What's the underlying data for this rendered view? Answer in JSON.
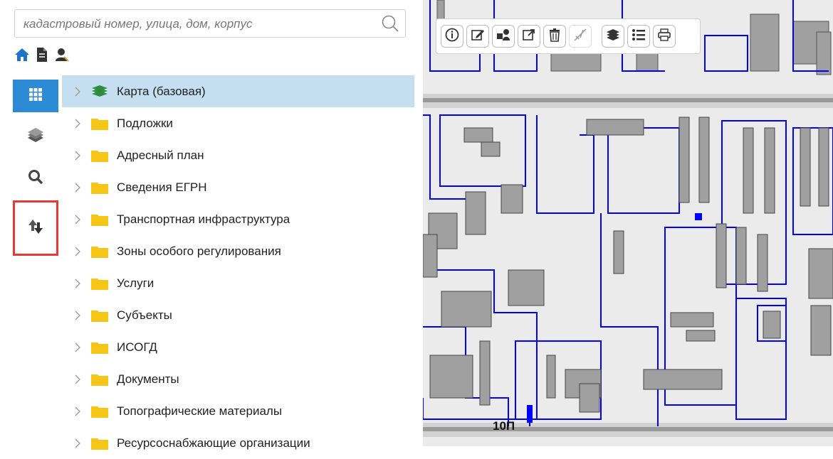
{
  "search": {
    "placeholder": "кадастровый номер, улица, дом, корпус"
  },
  "quick_icons": [
    "home-icon",
    "document-icon",
    "user-icon"
  ],
  "rail": [
    {
      "icon": "grid-icon",
      "active": true
    },
    {
      "icon": "layers-icon",
      "active": false
    },
    {
      "icon": "search-icon",
      "active": false
    },
    {
      "icon": "swap-icon",
      "active": false,
      "highlighted": true
    }
  ],
  "tree": {
    "items": [
      {
        "label": "Карта (базовая)",
        "selected": true,
        "icon": "layers-icon"
      },
      {
        "label": "Подложки",
        "icon": "folder-icon"
      },
      {
        "label": "Адресный план",
        "icon": "folder-icon"
      },
      {
        "label": "Сведения ЕГРН",
        "icon": "folder-icon"
      },
      {
        "label": "Транспортная инфраструктура",
        "icon": "folder-icon"
      },
      {
        "label": "Зоны особого регулирования",
        "icon": "folder-icon"
      },
      {
        "label": "Услуги",
        "icon": "folder-icon"
      },
      {
        "label": "Субъекты",
        "icon": "folder-icon"
      },
      {
        "label": "ИСОГД",
        "icon": "folder-icon"
      },
      {
        "label": "Документы",
        "icon": "folder-icon"
      },
      {
        "label": "Топографические материалы",
        "icon": "folder-icon"
      },
      {
        "label": "Ресурсоснабжающие организации",
        "icon": "folder-icon"
      }
    ]
  },
  "map": {
    "toolbar": [
      "info-icon",
      "edit-icon",
      "identify-icon",
      "export-icon",
      "delete-icon",
      "measure-icon",
      "layers-icon",
      "list-icon",
      "print-icon"
    ],
    "labels": {
      "road_label": "10П"
    }
  },
  "colors": {
    "accent": "#2d8bd6",
    "selected_row": "#c5def0",
    "highlight": "#e53935",
    "folder": "#f5c518",
    "layer_green": "#2e8b3e",
    "map_line": "#0000ff",
    "building": "#a0a0a0"
  }
}
